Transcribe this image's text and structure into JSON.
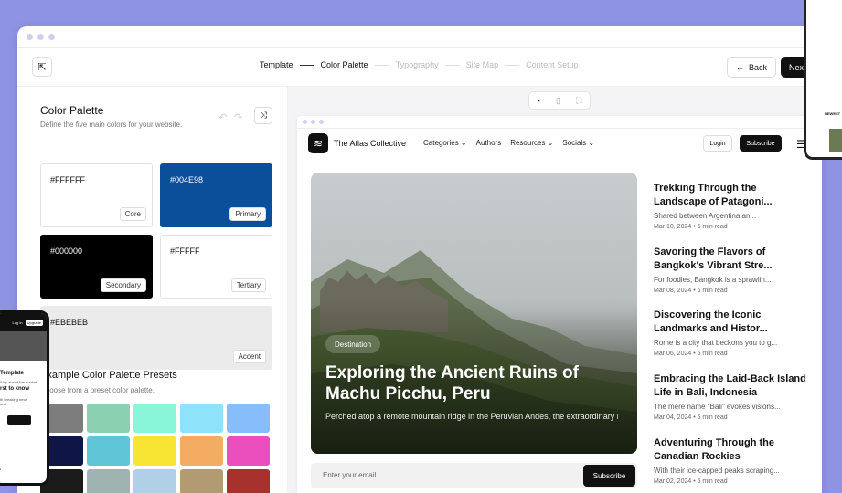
{
  "topbar": {
    "steps": [
      {
        "label": "Template",
        "state": "done"
      },
      {
        "label": "Color Palette",
        "state": "active"
      },
      {
        "label": "Typography",
        "state": "todo"
      },
      {
        "label": "Site Map",
        "state": "todo"
      },
      {
        "label": "Content Setup",
        "state": "todo"
      }
    ],
    "back_label": "Back",
    "next_label": "Next"
  },
  "palette": {
    "title": "Color Palette",
    "description": "Define the five main colors for your website.",
    "swatches": [
      {
        "hex": "#FFFFFF",
        "role": "Core",
        "color": "#FFFFFF",
        "text_color": "#111111"
      },
      {
        "hex": "#004E98",
        "role": "Primary",
        "color": "#0b4e9a",
        "text_color": "#ffffff"
      },
      {
        "hex": "#000000",
        "role": "Secondary",
        "color": "#000000",
        "text_color": "#ffffff"
      },
      {
        "hex": "#FFFFF",
        "role": "Tertiary",
        "color": "#FFFFFF",
        "text_color": "#111111"
      },
      {
        "hex": "#EBEBEB",
        "role": "Accent",
        "color": "#EBEBEB",
        "text_color": "#111111"
      }
    ],
    "presets_title": "Example Color Palette Presets",
    "presets_description": "Choose from a preset color palette.",
    "presets": [
      "#7d7d7d",
      "#8bd0b0",
      "#89f5d9",
      "#8ee3fb",
      "#87bdfa",
      "#0f1546",
      "#5fc4d6",
      "#f8e433",
      "#f4ac62",
      "#ea4fbd",
      "#1b1b1b",
      "#9fb3b0",
      "#b2cfe8",
      "#b29a73",
      "#a6312d"
    ]
  },
  "preview": {
    "site": {
      "brand": "The Atlas Collective",
      "menu": [
        "Categories ⌄",
        "Authors",
        "Resources ⌄",
        "Socials ⌄"
      ],
      "login_label": "Login",
      "subscribe_label": "Subscribe",
      "hero": {
        "tag": "Destination",
        "title": "Exploring the Ancient Ruins of Machu Picchu, Peru",
        "excerpt": "Perched atop a remote mountain ridge in the Peruvian Andes, the extraordinary ruins of Machu Picchu will ta..."
      },
      "email_placeholder": "Enter your email",
      "email_subscribe": "Subscribe",
      "articles": [
        {
          "title": "Trekking Through the Landscape of Patagoni...",
          "excerpt": "Shared between Argentina an...",
          "meta": "Mar 10, 2024 • 5 min read"
        },
        {
          "title": "Savoring the Flavors of Bangkok's Vibrant Stre...",
          "excerpt": "For foodies, Bangkok is a sprawlin...",
          "meta": "Mar 08, 2024 • 5 min read"
        },
        {
          "title": "Discovering the Iconic Landmarks and Histor...",
          "excerpt": "Rome is a city that beckons you to g...",
          "meta": "Mar 06, 2024 • 5 min read"
        },
        {
          "title": "Embracing the Laid-Back Island Life in Bali, Indonesia",
          "excerpt": "The mere name \"Bali\" evokes visions...",
          "meta": "Mar 04, 2024 • 5 min read"
        },
        {
          "title": "Adventuring Through the Canadian Rockies",
          "excerpt": "With their ice-capped peaks scraping...",
          "meta": "Mar 02, 2024 • 5 min read"
        }
      ]
    }
  },
  "phone": {
    "login": "Log In",
    "upgrade": "Upgrade",
    "title": "Template",
    "subtitle": "Stay ahead the market",
    "first_label": "rst to know",
    "small_text": "th breaking news and",
    "footer": "s"
  },
  "tablet": {
    "label": "NEWEST"
  }
}
